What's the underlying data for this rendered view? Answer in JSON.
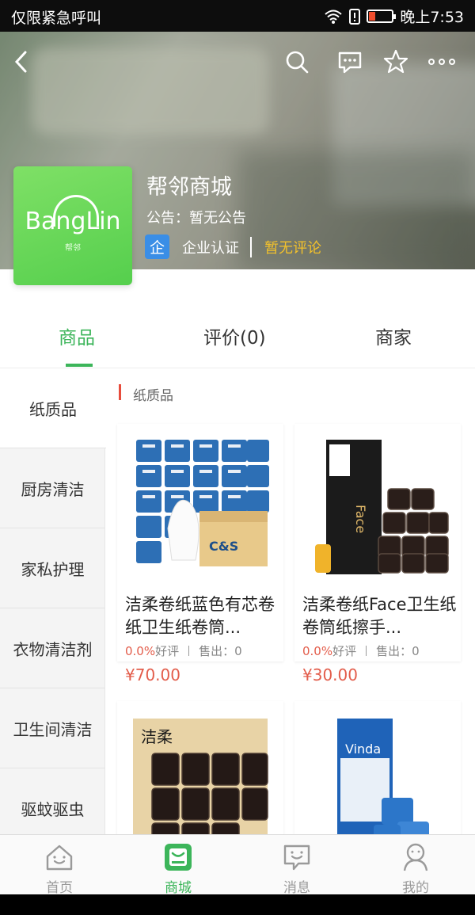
{
  "status_bar": {
    "carrier": "仅限紧急呼叫",
    "time": "晚上7:53",
    "battery_level": 0.25
  },
  "header": {
    "store_name": "帮邻商城",
    "notice": "公告：暂无公告",
    "cert_badge": "企",
    "cert_label": "企业认证",
    "review_status": "暂无评论",
    "logo_text": "BangLin",
    "logo_sub": "帮邻"
  },
  "tabs": [
    {
      "label": "商品",
      "active": true
    },
    {
      "label": "评价(0)",
      "active": false
    },
    {
      "label": "商家",
      "active": false
    }
  ],
  "categories": [
    "纸质品",
    "厨房清洁",
    "家私护理",
    "衣物清洁剂",
    "卫生间清洁",
    "驱蚊驱虫"
  ],
  "section_title": "纸质品",
  "products": [
    {
      "name": "洁柔卷纸蓝色有芯卷纸卫生纸卷筒...",
      "rating": "0.0%",
      "rating_label": "好评",
      "sold": "售出：0",
      "price": "¥70.00"
    },
    {
      "name": "洁柔卷纸Face卫生纸卷筒纸擦手...",
      "rating": "0.0%",
      "rating_label": "好评",
      "sold": "售出：0",
      "price": "¥30.00"
    },
    {
      "name": "",
      "rating": "",
      "rating_label": "",
      "sold": "",
      "price": ""
    },
    {
      "name": "",
      "rating": "",
      "rating_label": "",
      "sold": "",
      "price": ""
    }
  ],
  "bottom_nav": [
    {
      "label": "首页",
      "icon": "home-icon"
    },
    {
      "label": "商城",
      "icon": "shop-icon"
    },
    {
      "label": "消息",
      "icon": "message-icon"
    },
    {
      "label": "我的",
      "icon": "profile-icon"
    }
  ],
  "colors": {
    "accent": "#3cb55a",
    "price": "#e35d4b",
    "review": "#f3c12b",
    "cert": "#3a8ee6"
  }
}
